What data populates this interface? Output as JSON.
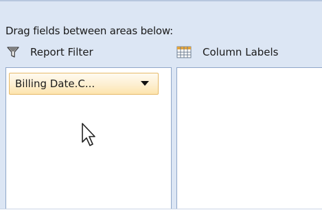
{
  "instructions": "Drag fields between areas below:",
  "areas": {
    "report_filter": {
      "label": "Report Filter",
      "icon": "filter-funnel-icon",
      "fields": [
        {
          "label": "Billing Date.C...",
          "icon": "dropdown-arrow-icon"
        }
      ]
    },
    "column_labels": {
      "label": "Column Labels",
      "icon": "column-grid-icon",
      "fields": []
    }
  },
  "colors": {
    "panel_background": "#dce6f4",
    "drop_area_border": "#8ea6c8",
    "field_button_fill": "#fdefd0",
    "field_button_border": "#e6b968"
  },
  "cursor": {
    "icon": "mouse-pointer-icon"
  }
}
